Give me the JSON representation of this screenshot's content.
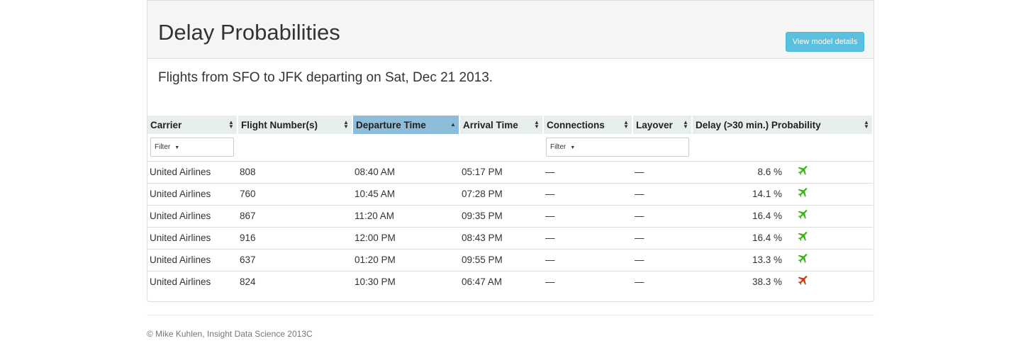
{
  "header": {
    "title": "Delay Probabilities",
    "model_button": "View model details"
  },
  "subtitle": "Flights from SFO to JFK departing on Sat, Dec 21 2013.",
  "table": {
    "columns": [
      {
        "label": "Carrier",
        "sort": "both"
      },
      {
        "label": "Flight Number(s)",
        "sort": "both"
      },
      {
        "label": "Departure Time",
        "sort": "ascending"
      },
      {
        "label": "Arrival Time",
        "sort": "both"
      },
      {
        "label": "Connections",
        "sort": "both"
      },
      {
        "label": "Layover",
        "sort": "both"
      },
      {
        "label": "Delay (>30 min.) Probability",
        "sort": "both"
      }
    ],
    "filters": {
      "carrier": "Filter",
      "connections": "Filter"
    },
    "rows": [
      {
        "carrier": "United Airlines",
        "flight": "808",
        "departure": "08:40 AM",
        "arrival": "05:17 PM",
        "connections": "—",
        "layover": "—",
        "probability": "8.6 %",
        "status_icon": "green-plane-icon"
      },
      {
        "carrier": "United Airlines",
        "flight": "760",
        "departure": "10:45 AM",
        "arrival": "07:28 PM",
        "connections": "—",
        "layover": "—",
        "probability": "14.1 %",
        "status_icon": "green-plane-icon"
      },
      {
        "carrier": "United Airlines",
        "flight": "867",
        "departure": "11:20 AM",
        "arrival": "09:35 PM",
        "connections": "—",
        "layover": "—",
        "probability": "16.4 %",
        "status_icon": "green-plane-icon"
      },
      {
        "carrier": "United Airlines",
        "flight": "916",
        "departure": "12:00 PM",
        "arrival": "08:43 PM",
        "connections": "—",
        "layover": "—",
        "probability": "16.4 %",
        "status_icon": "green-plane-icon"
      },
      {
        "carrier": "United Airlines",
        "flight": "637",
        "departure": "01:20 PM",
        "arrival": "09:55 PM",
        "connections": "—",
        "layover": "—",
        "probability": "13.3 %",
        "status_icon": "green-plane-icon"
      },
      {
        "carrier": "United Airlines",
        "flight": "824",
        "departure": "10:30 PM",
        "arrival": "06:47 AM",
        "connections": "—",
        "layover": "—",
        "probability": "38.3 %",
        "status_icon": "red-plane-icon"
      }
    ]
  },
  "footer": "© Mike Kuhlen, Insight Data Science 2013C",
  "colors": {
    "header_bg": "#e6eeee",
    "sorted_header_bg": "#8dbdd8",
    "button_bg": "#5bc0de",
    "plane_green": "#3cb518",
    "plane_red": "#cc3a0e"
  }
}
